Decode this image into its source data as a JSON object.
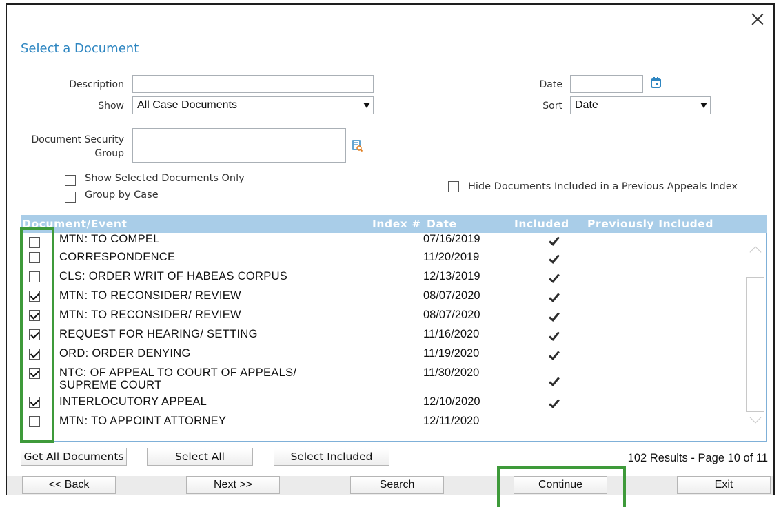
{
  "dialog": {
    "title": "Select a Document"
  },
  "form": {
    "description_label": "Description",
    "description_value": "",
    "show_label": "Show",
    "show_value": "All Case Documents",
    "date_label": "Date",
    "date_value": "",
    "sort_label": "Sort",
    "sort_value": "Date",
    "security_label_line1": "Document Security",
    "security_label_line2": "Group",
    "security_value": ""
  },
  "options": {
    "show_selected_only": "Show Selected Documents Only",
    "group_by_case": "Group by Case",
    "hide_prev_included": "Hide Documents Included in a Previous Appeals Index"
  },
  "grid": {
    "columns": {
      "document": "Document/Event",
      "index": "Index #",
      "date": "Date",
      "included": "Included",
      "prev_included": "Previously Included"
    },
    "rows": [
      {
        "checked": false,
        "description": "MTN: TO COMPEL",
        "date": "07/16/2019",
        "included": true
      },
      {
        "checked": false,
        "description": "CORRESPONDENCE",
        "date": "11/20/2019",
        "included": true
      },
      {
        "checked": false,
        "description": "CLS: ORDER WRIT OF HABEAS CORPUS",
        "date": "12/13/2019",
        "included": true
      },
      {
        "checked": true,
        "description": "MTN: TO RECONSIDER/ REVIEW",
        "date": "08/07/2020",
        "included": true
      },
      {
        "checked": true,
        "description": "MTN: TO RECONSIDER/ REVIEW",
        "date": "08/07/2020",
        "included": true
      },
      {
        "checked": true,
        "description": "REQUEST FOR HEARING/ SETTING",
        "date": "11/16/2020",
        "included": true
      },
      {
        "checked": true,
        "description": "ORD: ORDER DENYING",
        "date": "11/19/2020",
        "included": true
      },
      {
        "checked": true,
        "description": "NTC: OF APPEAL TO COURT OF APPEALS/",
        "description2": "SUPREME COURT",
        "date": "11/30/2020",
        "included": true
      },
      {
        "checked": true,
        "description": "INTERLOCUTORY APPEAL",
        "date": "12/10/2020",
        "included": true
      },
      {
        "checked": false,
        "description": "MTN: TO APPOINT ATTORNEY",
        "date": "12/11/2020",
        "included": false
      }
    ]
  },
  "actions": {
    "get_all": "Get All Documents",
    "select_all": "Select All",
    "select_included": "Select Included"
  },
  "results": "102 Results - Page 10 of 11",
  "footer": {
    "back": "<< Back",
    "next": "Next >>",
    "search": "Search",
    "continue": "Continue",
    "exit": "Exit"
  },
  "colors": {
    "title": "#2e86c1",
    "header": "#a9cde8",
    "highlight": "#3e9a3a"
  }
}
